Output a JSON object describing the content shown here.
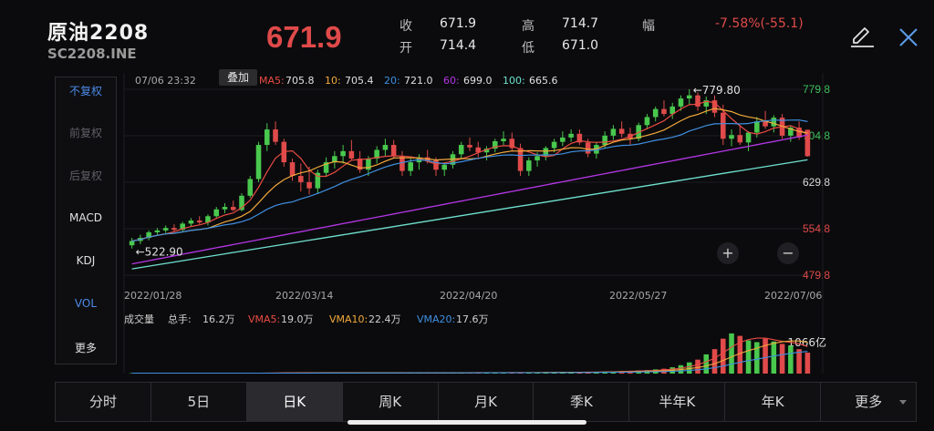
{
  "header": {
    "name": "原油2208",
    "code": "SC2208.INE",
    "price": "671.9",
    "stats": {
      "close_label": "收",
      "close_value": "671.9",
      "open_label": "开",
      "open_value": "714.4",
      "high_label": "高",
      "high_value": "714.7",
      "low_label": "低",
      "low_value": "671.0",
      "change_label": "幅",
      "change_value": "-7.58%(-55.1)"
    },
    "icons": [
      "edit-icon",
      "close-icon"
    ]
  },
  "left_panel": {
    "items": [
      {
        "label": "不复权",
        "state": "active"
      },
      {
        "label": "前复权",
        "state": "dim"
      },
      {
        "label": "后复权",
        "state": "dim"
      },
      {
        "label": "MACD",
        "state": "normal"
      },
      {
        "label": "KDJ",
        "state": "normal"
      },
      {
        "label": "VOL",
        "state": "active"
      },
      {
        "label": "更多",
        "state": "normal"
      }
    ]
  },
  "overlay_tag": "叠加",
  "chart_data": {
    "type": "candlestick",
    "info_datetime": "07/06 23:32",
    "ma_legend": [
      {
        "key": "MA5:",
        "value": "705.8",
        "color": "#ea4b43"
      },
      {
        "key": "10:",
        "value": "705.4",
        "color": "#f2a93b"
      },
      {
        "key": "20:",
        "value": "721.0",
        "color": "#3f8fe0"
      },
      {
        "key": "60:",
        "value": "699.0",
        "color": "#b436e6"
      },
      {
        "key": "100:",
        "value": "665.6",
        "color": "#6fe0cf"
      }
    ],
    "y_ticks": [
      {
        "label": "779.8",
        "value": 779.8,
        "color": "#3fbf5a"
      },
      {
        "label": "704.8",
        "value": 704.8,
        "color": "#3fbf5a"
      },
      {
        "label": "629.8",
        "value": 629.8,
        "color": "#d8d8d8"
      },
      {
        "label": "554.8",
        "value": 554.8,
        "color": "#e04a4a"
      },
      {
        "label": "479.8",
        "value": 479.8,
        "color": "#e04a4a"
      }
    ],
    "ylim": [
      479.8,
      779.8
    ],
    "x_labels": [
      "2022/01/28",
      "2022/03/14",
      "2022/04/20",
      "2022/05/27",
      "2022/07/06"
    ],
    "annotations": [
      {
        "text": "←779.80",
        "value": 779.8
      },
      {
        "text": "←522.90",
        "value": 522.9
      }
    ],
    "candles": [
      [
        528,
        540,
        522.9,
        535
      ],
      [
        535,
        545,
        530,
        540
      ],
      [
        540,
        552,
        536,
        549
      ],
      [
        549,
        556,
        545,
        552
      ],
      [
        552,
        560,
        548,
        556
      ],
      [
        556,
        562,
        550,
        553
      ],
      [
        553,
        566,
        551,
        563
      ],
      [
        563,
        572,
        558,
        568
      ],
      [
        568,
        575,
        562,
        565
      ],
      [
        565,
        578,
        560,
        575
      ],
      [
        575,
        590,
        572,
        586
      ],
      [
        586,
        596,
        580,
        590
      ],
      [
        590,
        600,
        583,
        585
      ],
      [
        585,
        612,
        583,
        608
      ],
      [
        608,
        640,
        605,
        635
      ],
      [
        635,
        695,
        630,
        690
      ],
      [
        690,
        725,
        680,
        715
      ],
      [
        715,
        728,
        690,
        695
      ],
      [
        695,
        700,
        655,
        662
      ],
      [
        662,
        668,
        632,
        640
      ],
      [
        640,
        660,
        615,
        630
      ],
      [
        630,
        655,
        610,
        620
      ],
      [
        620,
        650,
        612,
        645
      ],
      [
        645,
        670,
        640,
        662
      ],
      [
        662,
        680,
        652,
        672
      ],
      [
        672,
        690,
        660,
        680
      ],
      [
        680,
        698,
        665,
        668
      ],
      [
        668,
        680,
        645,
        650
      ],
      [
        650,
        672,
        640,
        668
      ],
      [
        668,
        688,
        660,
        682
      ],
      [
        682,
        700,
        672,
        690
      ],
      [
        690,
        698,
        668,
        672
      ],
      [
        672,
        680,
        640,
        648
      ],
      [
        648,
        668,
        640,
        662
      ],
      [
        662,
        675,
        650,
        670
      ],
      [
        670,
        682,
        660,
        665
      ],
      [
        665,
        670,
        640,
        650
      ],
      [
        650,
        662,
        640,
        658
      ],
      [
        658,
        680,
        652,
        675
      ],
      [
        675,
        695,
        668,
        690
      ],
      [
        690,
        702,
        680,
        686
      ],
      [
        686,
        695,
        670,
        678
      ],
      [
        678,
        688,
        665,
        684
      ],
      [
        684,
        700,
        678,
        696
      ],
      [
        696,
        712,
        690,
        700
      ],
      [
        700,
        710,
        680,
        685
      ],
      [
        685,
        692,
        640,
        648
      ],
      [
        648,
        670,
        640,
        665
      ],
      [
        665,
        678,
        655,
        672
      ],
      [
        672,
        688,
        665,
        685
      ],
      [
        685,
        700,
        678,
        695
      ],
      [
        695,
        712,
        688,
        702
      ],
      [
        702,
        715,
        695,
        708
      ],
      [
        708,
        715,
        690,
        694
      ],
      [
        694,
        700,
        670,
        676
      ],
      [
        676,
        695,
        668,
        690
      ],
      [
        690,
        712,
        684,
        705
      ],
      [
        705,
        722,
        698,
        716
      ],
      [
        716,
        728,
        702,
        708
      ],
      [
        708,
        718,
        690,
        700
      ],
      [
        700,
        726,
        696,
        722
      ],
      [
        722,
        740,
        715,
        735
      ],
      [
        735,
        752,
        728,
        748
      ],
      [
        748,
        762,
        736,
        740
      ],
      [
        740,
        758,
        732,
        752
      ],
      [
        752,
        770,
        745,
        765
      ],
      [
        765,
        779.8,
        755,
        770
      ],
      [
        770,
        775,
        745,
        752
      ],
      [
        752,
        768,
        740,
        762
      ],
      [
        762,
        770,
        735,
        742
      ],
      [
        742,
        755,
        690,
        700
      ],
      [
        700,
        715,
        688,
        706
      ],
      [
        706,
        722,
        690,
        694
      ],
      [
        694,
        712,
        680,
        710
      ],
      [
        710,
        735,
        702,
        728
      ],
      [
        728,
        745,
        716,
        720
      ],
      [
        720,
        738,
        710,
        734
      ],
      [
        734,
        740,
        700,
        705
      ],
      [
        705,
        722,
        695,
        718
      ],
      [
        718,
        728,
        698,
        702
      ],
      [
        714.4,
        714.7,
        671.0,
        671.9
      ]
    ],
    "volume": {
      "label": "成交量",
      "total_label": "总手:",
      "total_value": "16.2万",
      "legend": [
        {
          "key": "VMA5:",
          "value": "19.0万",
          "color": "#ea4b43"
        },
        {
          "key": "VMA10:",
          "value": "22.4万",
          "color": "#f2a93b"
        },
        {
          "key": "VMA20:",
          "value": "17.6万",
          "color": "#3f8fe0"
        }
      ],
      "axis_label": "1066亿",
      "values": [
        1,
        1,
        1,
        1,
        1,
        1,
        1,
        1,
        1,
        1,
        1,
        1,
        1,
        1,
        2,
        2,
        2,
        2,
        2,
        2,
        2,
        2,
        2,
        2,
        2,
        2,
        2,
        2,
        2,
        2,
        2,
        2,
        2,
        2,
        2,
        2,
        2,
        2,
        3,
        3,
        3,
        3,
        3,
        3,
        3,
        3,
        3,
        3,
        3,
        4,
        4,
        4,
        4,
        4,
        5,
        5,
        6,
        6,
        7,
        8,
        9,
        10,
        12,
        14,
        18,
        24,
        32,
        40,
        55,
        70,
        100,
        115,
        108,
        95,
        90,
        100,
        92,
        85,
        80,
        70,
        60
      ]
    }
  },
  "tabs": [
    {
      "label": "分时",
      "active": false
    },
    {
      "label": "5日",
      "active": false
    },
    {
      "label": "日K",
      "active": true
    },
    {
      "label": "周K",
      "active": false
    },
    {
      "label": "月K",
      "active": false
    },
    {
      "label": "季K",
      "active": false
    },
    {
      "label": "半年K",
      "active": false
    },
    {
      "label": "年K",
      "active": false
    },
    {
      "label": "更多",
      "active": false,
      "dropdown": true
    }
  ]
}
